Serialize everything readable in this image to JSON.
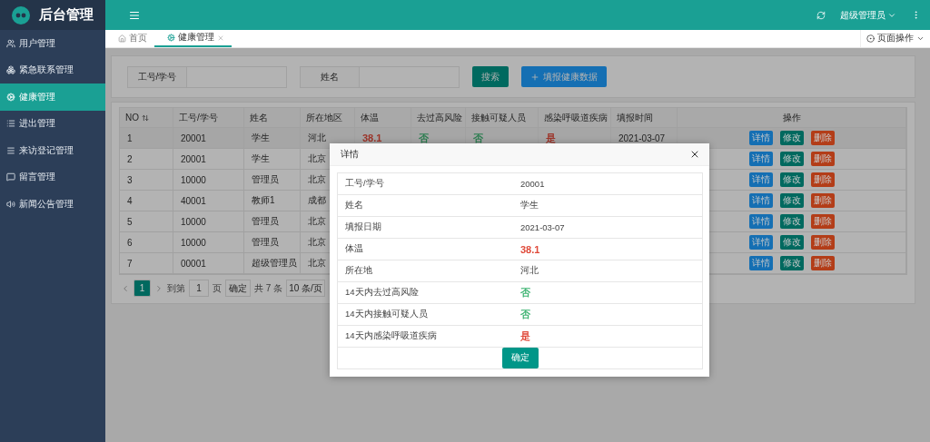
{
  "app": {
    "title": "后台管理",
    "user": "超级管理员"
  },
  "sidebar": {
    "items": [
      {
        "label": "用户管理",
        "selected": false
      },
      {
        "label": "紧急联系管理",
        "selected": false
      },
      {
        "label": "健康管理",
        "selected": true
      },
      {
        "label": "进出管理",
        "selected": false
      },
      {
        "label": "来访登记管理",
        "selected": false
      },
      {
        "label": "留言管理",
        "selected": false
      },
      {
        "label": "新闻公告管理",
        "selected": false
      }
    ]
  },
  "tabs": [
    {
      "label": "首页",
      "selected": false,
      "closable": false
    },
    {
      "label": "健康管理",
      "selected": true,
      "closable": true
    }
  ],
  "page_actions": "页面操作",
  "search": {
    "fields": [
      {
        "label": "工号/学号"
      },
      {
        "label": "姓名"
      }
    ],
    "buttons": [
      {
        "label": "搜索",
        "kind": "primary"
      },
      {
        "label": "填报健康数据",
        "kind": "add"
      }
    ]
  },
  "table": {
    "columns": [
      "NO",
      "工号/学号",
      "姓名",
      "所在地区",
      "体温",
      "去过高风险",
      "接触可疑人员",
      "感染呼吸道疾病",
      "填报时间",
      "操作"
    ],
    "rows": [
      {
        "selected": true,
        "cells": [
          {
            "text": "1"
          },
          {
            "text": "20001"
          },
          {
            "text": "学生"
          },
          {
            "text": "河北"
          },
          {
            "text": "38.1",
            "color": "#9d3429"
          },
          {
            "text": "否",
            "color": "#2a7d4f"
          },
          {
            "text": "否",
            "color": "#2a7d4f"
          },
          {
            "text": "是",
            "color": "#9d3429"
          },
          {
            "text": "2021-03-07"
          }
        ],
        "actions": [
          {
            "label": "详情",
            "kind": "info"
          },
          {
            "label": "修改",
            "kind": "edit"
          },
          {
            "label": "删除",
            "kind": "delete"
          }
        ]
      },
      {
        "selected": false,
        "cells": [
          {
            "text": "2"
          },
          {
            "text": "20001"
          },
          {
            "text": "学生"
          },
          {
            "text": "北京"
          }
        ],
        "actions": [
          {
            "label": "详情",
            "kind": "info"
          },
          {
            "label": "修改",
            "kind": "edit"
          },
          {
            "label": "删除",
            "kind": "delete"
          }
        ]
      },
      {
        "selected": false,
        "cells": [
          {
            "text": "3"
          },
          {
            "text": "10000"
          },
          {
            "text": "管理员"
          },
          {
            "text": "北京"
          }
        ],
        "actions": [
          {
            "label": "详情",
            "kind": "info"
          },
          {
            "label": "修改",
            "kind": "edit"
          },
          {
            "label": "删除",
            "kind": "delete"
          }
        ]
      },
      {
        "selected": false,
        "cells": [
          {
            "text": "4"
          },
          {
            "text": "40001"
          },
          {
            "text": "教师1"
          },
          {
            "text": "成都"
          }
        ],
        "actions": [
          {
            "label": "详情",
            "kind": "info"
          },
          {
            "label": "修改",
            "kind": "edit"
          },
          {
            "label": "删除",
            "kind": "delete"
          }
        ]
      },
      {
        "selected": false,
        "cells": [
          {
            "text": "5"
          },
          {
            "text": "10000"
          },
          {
            "text": "管理员"
          },
          {
            "text": "北京"
          }
        ],
        "actions": [
          {
            "label": "详情",
            "kind": "info"
          },
          {
            "label": "修改",
            "kind": "edit"
          },
          {
            "label": "删除",
            "kind": "delete"
          }
        ]
      },
      {
        "selected": false,
        "cells": [
          {
            "text": "6"
          },
          {
            "text": "10000"
          },
          {
            "text": "管理员"
          },
          {
            "text": "北京"
          }
        ],
        "actions": [
          {
            "label": "详情",
            "kind": "info"
          },
          {
            "label": "修改",
            "kind": "edit"
          },
          {
            "label": "删除",
            "kind": "delete"
          }
        ]
      },
      {
        "selected": false,
        "cells": [
          {
            "text": "7"
          },
          {
            "text": "00001"
          },
          {
            "text": "超级管理员"
          },
          {
            "text": "北京"
          }
        ],
        "actions": [
          {
            "label": "详情",
            "kind": "info"
          },
          {
            "label": "修改",
            "kind": "edit"
          },
          {
            "label": "删除",
            "kind": "delete"
          }
        ]
      }
    ]
  },
  "pagination": {
    "pages": [
      {
        "label": "1",
        "selected": true
      }
    ],
    "goto_label": "到第",
    "goto_value": "1",
    "page_unit": "页",
    "confirm": "确定",
    "total": "共 7 条",
    "page_size": "10 条/页"
  },
  "dialog": {
    "title": "详情",
    "rows": [
      {
        "label": "工号/学号",
        "value": "20001"
      },
      {
        "label": "姓名",
        "value": "学生"
      },
      {
        "label": "填报日期",
        "value": "2021-03-07"
      },
      {
        "label": "体温",
        "value": "38.1",
        "color": "#e04a3a"
      },
      {
        "label": "所在地",
        "value": "河北"
      },
      {
        "label": "14天内去过高风险",
        "value": "否",
        "color": "#3cb371"
      },
      {
        "label": "14天内接触可疑人员",
        "value": "否",
        "color": "#3cb371"
      },
      {
        "label": "14天内感染呼吸道疾病",
        "value": "是",
        "color": "#e04a3a"
      }
    ],
    "button": "确定"
  }
}
